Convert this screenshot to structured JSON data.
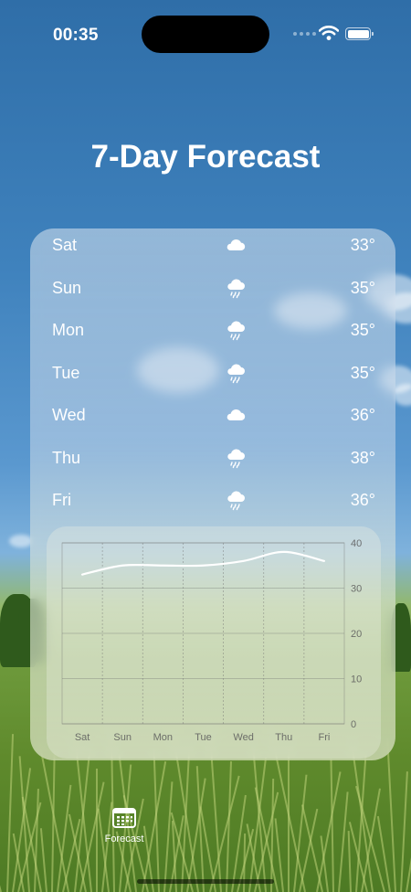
{
  "status_bar": {
    "time": "00:35"
  },
  "title": "7-Day Forecast",
  "forecast": [
    {
      "day": "Sat",
      "icon": "cloud-icon",
      "temp": "33°"
    },
    {
      "day": "Sun",
      "icon": "cloud-rain-icon",
      "temp": "35°"
    },
    {
      "day": "Mon",
      "icon": "cloud-rain-icon",
      "temp": "35°"
    },
    {
      "day": "Tue",
      "icon": "cloud-rain-icon",
      "temp": "35°"
    },
    {
      "day": "Wed",
      "icon": "cloud-icon",
      "temp": "36°"
    },
    {
      "day": "Thu",
      "icon": "cloud-rain-icon",
      "temp": "38°"
    },
    {
      "day": "Fri",
      "icon": "cloud-rain-icon",
      "temp": "36°"
    }
  ],
  "chart_data": {
    "type": "line",
    "categories": [
      "Sat",
      "Sun",
      "Mon",
      "Tue",
      "Wed",
      "Thu",
      "Fri"
    ],
    "series": [
      {
        "values": [
          33,
          35,
          35,
          35,
          36,
          38,
          36
        ]
      }
    ],
    "ylim": [
      0,
      40
    ],
    "yticks": [
      0,
      10,
      20,
      30,
      40
    ],
    "ytick_labels": [
      "0",
      "10",
      "20",
      "30",
      "40"
    ],
    "y_axis_side": "right",
    "grid": true,
    "line_color": "#ffffff"
  },
  "tab_bar": {
    "forecast_label": "Forecast"
  }
}
